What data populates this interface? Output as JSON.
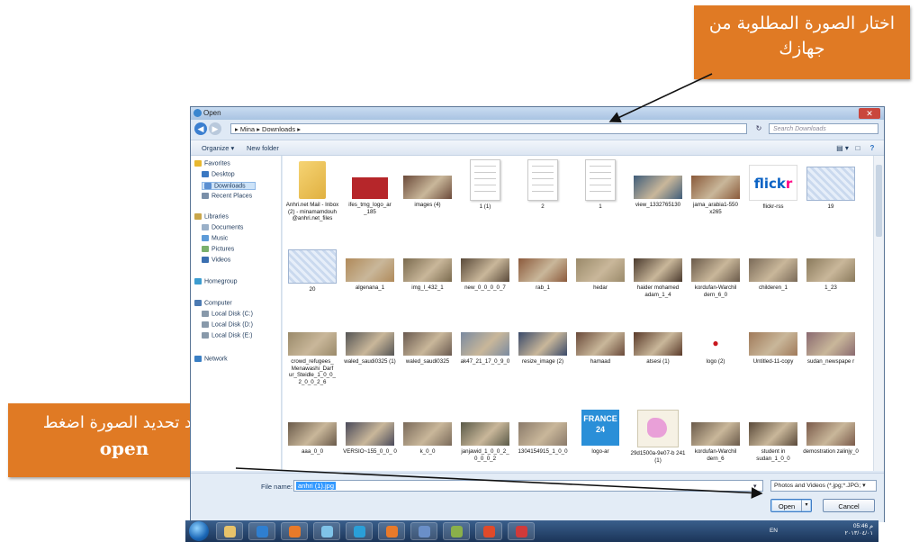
{
  "callouts": {
    "top_line1": "اختار الصورة المطلوبة من",
    "top_line2": "جهازك",
    "bottom_line1": "بعد تحديد الصورة اضغط",
    "bottom_line2": "open"
  },
  "dialog": {
    "title": "Open",
    "close_glyph": "✕",
    "back_glyph": "◀",
    "forward_glyph": "▶",
    "address": "▸ Mina ▸ Downloads ▸",
    "refresh_glyph": "↻",
    "search_placeholder": "Search Downloads",
    "toolbar": {
      "organize": "Organize ▾",
      "new_folder": "New folder",
      "view_glyph": "▤ ▾",
      "pane_glyph": "□",
      "help_glyph": "?"
    }
  },
  "nav": [
    {
      "label": "Favorites",
      "level": 0,
      "color": "#e8b830"
    },
    {
      "label": "Desktop",
      "level": 1,
      "color": "#3a78c2"
    },
    {
      "label": "Downloads",
      "level": 1,
      "color": "#5b8fd1",
      "selected": true
    },
    {
      "label": "Recent Places",
      "level": 1,
      "color": "#7a8fa8"
    },
    {
      "label": "Libraries",
      "level": 0,
      "color": "#c9a64a"
    },
    {
      "label": "Documents",
      "level": 1,
      "color": "#9ab0c8"
    },
    {
      "label": "Music",
      "level": 1,
      "color": "#5d9bd8"
    },
    {
      "label": "Pictures",
      "level": 1,
      "color": "#7ab06c"
    },
    {
      "label": "Videos",
      "level": 1,
      "color": "#3b6fb0"
    },
    {
      "label": "Homegroup",
      "level": 0,
      "color": "#3c9cd0"
    },
    {
      "label": "Computer",
      "level": 0,
      "color": "#4c7ab2"
    },
    {
      "label": "Local Disk (C:)",
      "level": 1,
      "color": "#8899aa"
    },
    {
      "label": "Local Disk (D:)",
      "level": 1,
      "color": "#8899aa"
    },
    {
      "label": "Local Disk (E:)",
      "level": 1,
      "color": "#8899aa"
    },
    {
      "label": "Network",
      "level": 0,
      "color": "#3a7fc4"
    }
  ],
  "files": [
    {
      "label": "Anhri.net Mail - Inbox (2) - minamamdouh @anhri.net_files",
      "kind": "folder"
    },
    {
      "label": "ifes_tmg_logo_ar _185",
      "kind": "book",
      "color": "#b6262a"
    },
    {
      "label": "images (4)",
      "kind": "photo",
      "color": "#6b4a3a"
    },
    {
      "label": "1 (1)",
      "kind": "doc"
    },
    {
      "label": "2",
      "kind": "doc"
    },
    {
      "label": "1",
      "kind": "doc"
    },
    {
      "label": "view_1332765130",
      "kind": "photo",
      "color": "#3f5d7a"
    },
    {
      "label": "jama_arabia1-550 x265",
      "kind": "photo",
      "color": "#8a5a3a"
    },
    {
      "label": "flickr-rss",
      "kind": "flickr"
    },
    {
      "label": "19",
      "kind": "blueframe"
    },
    {
      "label": "20",
      "kind": "blueframe"
    },
    {
      "label": "algenana_1",
      "kind": "photo",
      "color": "#b08a5a"
    },
    {
      "label": "img_l_432_1",
      "kind": "photo",
      "color": "#7a6a4e"
    },
    {
      "label": "new_0_0_0_0_7",
      "kind": "photo",
      "color": "#5a4a3a"
    },
    {
      "label": "rab_1",
      "kind": "photo",
      "color": "#8c5a3c"
    },
    {
      "label": "hedar",
      "kind": "photo",
      "color": "#9a8a6a"
    },
    {
      "label": "haider mohamed adam_1_4",
      "kind": "photo",
      "color": "#4a3a2e"
    },
    {
      "label": "kordufan-Warchil dern_6_0",
      "kind": "photo",
      "color": "#6a5a4a"
    },
    {
      "label": "childeren_1",
      "kind": "photo",
      "color": "#7a6a58"
    },
    {
      "label": "1_23",
      "kind": "photo",
      "color": "#8a7a5c"
    },
    {
      "label": "crowd_refugees_ Menawashi_Darf ur_Steidle_1_0_0_ 2_0_0_2_6",
      "kind": "photo",
      "color": "#9a8a6a"
    },
    {
      "label": "waled_saudi0325 (1)",
      "kind": "photo",
      "color": "#555555"
    },
    {
      "label": "waled_saudi0325",
      "kind": "photo",
      "color": "#6a5a50"
    },
    {
      "label": "ak47_21_17_0_9_0",
      "kind": "photo",
      "color": "#7a8aa0"
    },
    {
      "label": "resize_image (2)",
      "kind": "photo",
      "color": "#3a4a6a"
    },
    {
      "label": "hamaad",
      "kind": "photo",
      "color": "#6a4a3a"
    },
    {
      "label": "atsesi (1)",
      "kind": "photo",
      "color": "#5a3a2a"
    },
    {
      "label": "logo (2)",
      "kind": "logo"
    },
    {
      "label": "Untitled-11-copy",
      "kind": "photo",
      "color": "#a07a5a"
    },
    {
      "label": "sudan_newspape r",
      "kind": "photo",
      "color": "#8a6a70"
    },
    {
      "label": "aaa_0_0",
      "kind": "photo",
      "color": "#6a5a4a"
    },
    {
      "label": "VERSIO~155_0_0_ 0",
      "kind": "photo",
      "color": "#4a4a5a"
    },
    {
      "label": "k_0_0",
      "kind": "photo",
      "color": "#7a6a5a"
    },
    {
      "label": "janjawid_1_0_0_2_ 0_0_0_2",
      "kind": "photo",
      "color": "#5a5a48"
    },
    {
      "label": "1304154915_1_0_0",
      "kind": "photo",
      "color": "#8a7a6a"
    },
    {
      "label": "logo-ar",
      "kind": "france24",
      "text": "FRANCE 24"
    },
    {
      "label": "29d1500a-9e07-b 241 (1)",
      "kind": "map"
    },
    {
      "label": "kordufan-Warchil dern_6",
      "kind": "photo",
      "color": "#6a5a4a"
    },
    {
      "label": "student in sudan_1_0_0",
      "kind": "photo",
      "color": "#5a4a3a"
    },
    {
      "label": "demostration zalinjy_0",
      "kind": "photo",
      "color": "#7a5a4a"
    }
  ],
  "bottom": {
    "filename_label": "File name:",
    "filename_value": "anhri (1).jpg",
    "filename_drop": "▾",
    "filter_value": "Photos and Videos (*.jpg;*.JPG;  ▾",
    "open_label": "Open",
    "open_arrow": "▾",
    "cancel_label": "Cancel"
  },
  "taskbar": {
    "lang": "EN",
    "time": "05:46 م",
    "date": "٢٠١٣/٠٤/٠١",
    "apps": [
      "#e8c36a",
      "#2f7fd0",
      "#e87a2a",
      "#7fc3e8",
      "#2a9fd8",
      "#e87a2a",
      "#6a8fc8",
      "#8ab04a",
      "#e04a2a",
      "#d03a3a"
    ]
  }
}
